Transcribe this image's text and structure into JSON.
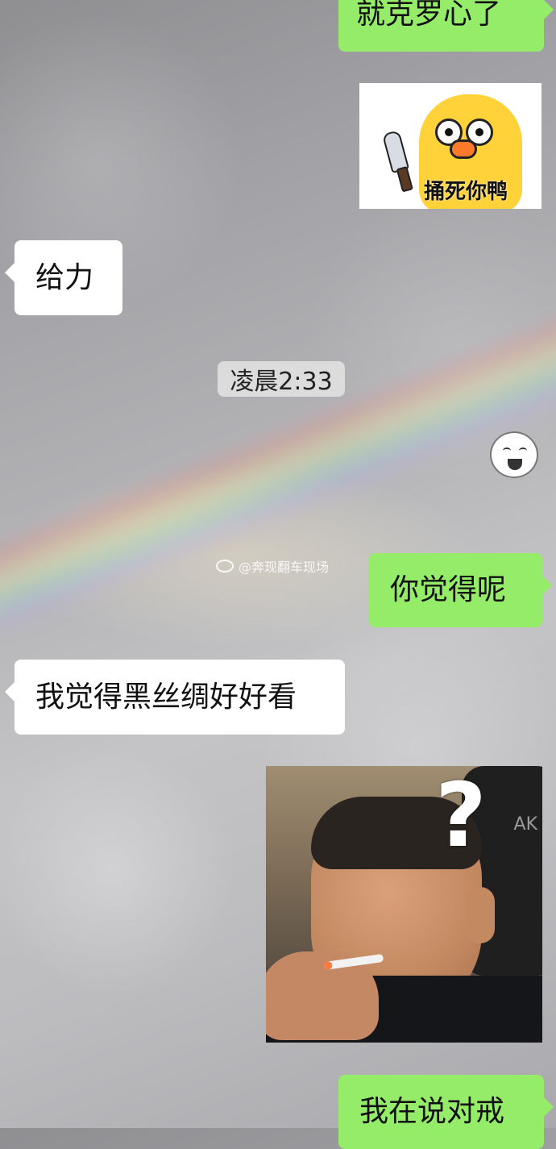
{
  "messages": [
    {
      "side": "right",
      "type": "text",
      "text": "就克罗心了"
    },
    {
      "side": "right",
      "type": "sticker",
      "caption": "捅死你鸭"
    },
    {
      "side": "left",
      "type": "text",
      "text": "给力"
    },
    {
      "type": "timestamp",
      "text": "凌晨2:33"
    },
    {
      "side": "right",
      "type": "sticker",
      "icon": "laughing-face-sticker"
    },
    {
      "side": "right",
      "type": "text",
      "text": "你觉得呢"
    },
    {
      "side": "left",
      "type": "text",
      "text": "我觉得黑丝绸好好看"
    },
    {
      "side": "right",
      "type": "image",
      "label": "AK"
    },
    {
      "side": "right",
      "type": "text",
      "text": "我在说对戒"
    }
  ],
  "watermark": {
    "icon": "weibo-icon",
    "text": "@奔现翻车现场"
  },
  "colors": {
    "outgoing_bubble": "#95ec69",
    "incoming_bubble": "#ffffff"
  }
}
